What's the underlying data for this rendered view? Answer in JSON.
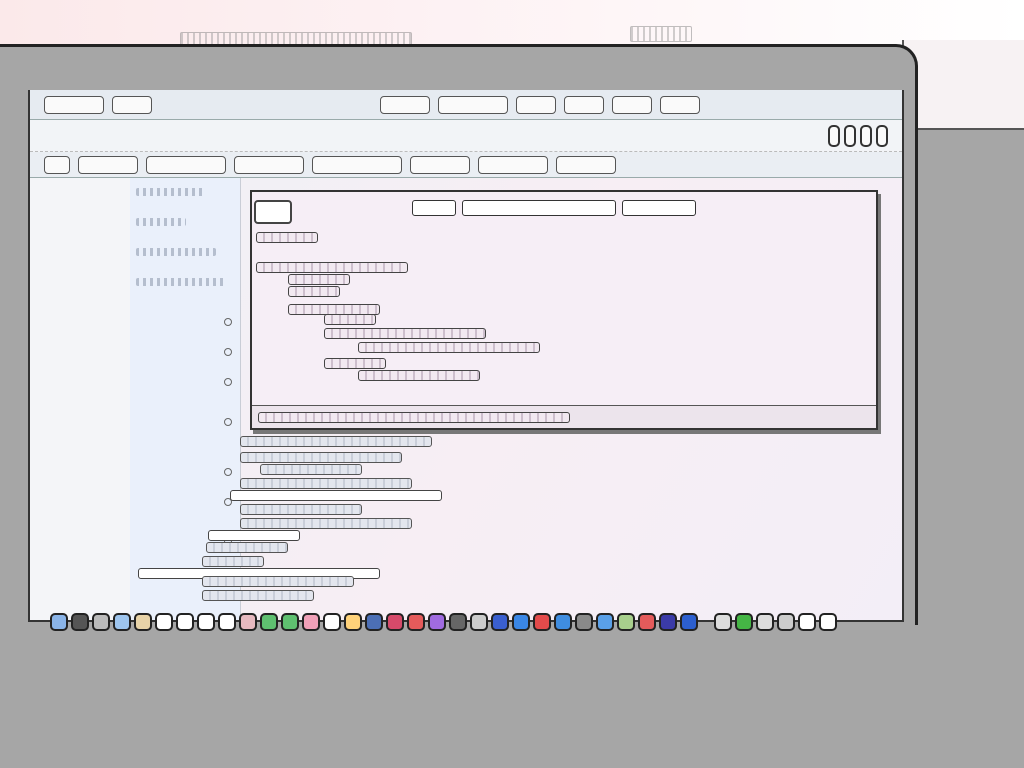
{
  "window": {
    "title": "",
    "toolbar_buttons": [
      "",
      "",
      "",
      "",
      "",
      "",
      "",
      ""
    ],
    "tab_labels": [
      "",
      "",
      "",
      "",
      "",
      "",
      "",
      ""
    ]
  },
  "popup": {
    "title_parts": [
      "",
      "",
      ""
    ],
    "status_text": ""
  },
  "colors": {
    "background_bezel": "#a6a6a6",
    "screen_bg": "#f4eef5",
    "gutter_bg": "#eaf0fb",
    "popup_bg": "#f6eef6"
  },
  "dock": {
    "icons": [
      {
        "name": "finder-icon",
        "color": "#8ab4e8"
      },
      {
        "name": "dashboard-icon",
        "color": "#555555"
      },
      {
        "name": "system-prefs-icon",
        "color": "#bbbbbb"
      },
      {
        "name": "safari-icon",
        "color": "#9ec5ee"
      },
      {
        "name": "mail-icon",
        "color": "#e8d3a8"
      },
      {
        "name": "ical-icon",
        "color": "#ffffff"
      },
      {
        "name": "app-icon-1",
        "color": "#ffffff"
      },
      {
        "name": "app-icon-2",
        "color": "#ffffff"
      },
      {
        "name": "app-icon-3",
        "color": "#ffffff"
      },
      {
        "name": "app-icon-4",
        "color": "#e7b9c0"
      },
      {
        "name": "messages-icon",
        "color": "#5fbf70"
      },
      {
        "name": "facetime-icon",
        "color": "#5fbf70"
      },
      {
        "name": "app-icon-5",
        "color": "#f0a0b8"
      },
      {
        "name": "app-icon-6",
        "color": "#ffffff"
      },
      {
        "name": "app-icon-7",
        "color": "#ffd27a"
      },
      {
        "name": "app-icon-8",
        "color": "#4c6fb5"
      },
      {
        "name": "app-icon-9",
        "color": "#d64a6a"
      },
      {
        "name": "app-icon-10",
        "color": "#e55b5b"
      },
      {
        "name": "app-icon-11",
        "color": "#a06be0"
      },
      {
        "name": "app-icon-12",
        "color": "#666666"
      },
      {
        "name": "app-icon-13",
        "color": "#cccccc"
      },
      {
        "name": "app-icon-14",
        "color": "#3a5fcf"
      },
      {
        "name": "app-icon-15",
        "color": "#3a87e6"
      },
      {
        "name": "app-icon-16",
        "color": "#e34b4b"
      },
      {
        "name": "app-icon-17",
        "color": "#3f8de0"
      },
      {
        "name": "app-icon-18",
        "color": "#8a8a8a"
      },
      {
        "name": "app-icon-19",
        "color": "#5aa0e8"
      },
      {
        "name": "app-icon-20",
        "color": "#a8d08d"
      },
      {
        "name": "app-icon-21",
        "color": "#e45b5b"
      },
      {
        "name": "app-icon-22",
        "color": "#3b3ba8"
      },
      {
        "name": "app-icon-23",
        "color": "#2c5fcf"
      }
    ],
    "extras": [
      {
        "name": "downloads-icon",
        "color": "#dddddd"
      },
      {
        "name": "green-app-icon",
        "color": "#45b545"
      },
      {
        "name": "folder-icon",
        "color": "#dddddd"
      },
      {
        "name": "stack-icon",
        "color": "#cccccc"
      },
      {
        "name": "lock-icon",
        "color": "#ffffff"
      },
      {
        "name": "trash-icon",
        "color": "#ffffff"
      }
    ]
  }
}
